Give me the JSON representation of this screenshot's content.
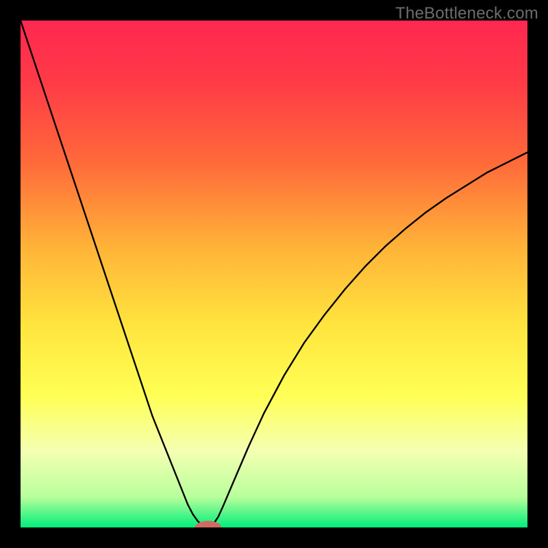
{
  "watermark": "TheBottleneck.com",
  "chart_data": {
    "type": "line",
    "title": "",
    "xlabel": "",
    "ylabel": "",
    "xlim": [
      0,
      100
    ],
    "ylim": [
      0,
      100
    ],
    "grid": false,
    "gradient_stops": [
      {
        "offset": 0.0,
        "color": "#ff2850"
      },
      {
        "offset": 0.12,
        "color": "#ff3a47"
      },
      {
        "offset": 0.28,
        "color": "#ff6a3a"
      },
      {
        "offset": 0.45,
        "color": "#ffb438"
      },
      {
        "offset": 0.6,
        "color": "#ffe43e"
      },
      {
        "offset": 0.74,
        "color": "#ffff55"
      },
      {
        "offset": 0.85,
        "color": "#f4ffb2"
      },
      {
        "offset": 0.94,
        "color": "#b8ff9c"
      },
      {
        "offset": 1.0,
        "color": "#00ee7a"
      }
    ],
    "series": [
      {
        "name": "left-curve",
        "x": [
          0,
          2,
          4,
          6,
          8,
          10,
          12,
          14,
          16,
          18,
          20,
          22,
          24,
          26,
          28,
          30,
          32,
          33,
          34,
          35,
          36,
          37
        ],
        "y": [
          100,
          94,
          88,
          82,
          76,
          70,
          64,
          58,
          52,
          46,
          40,
          34,
          28,
          22,
          17,
          12,
          7,
          4.5,
          2.6,
          1.2,
          0.3,
          0
        ]
      },
      {
        "name": "right-curve",
        "x": [
          37,
          38,
          39,
          40,
          42,
          45,
          48,
          52,
          56,
          60,
          64,
          68,
          72,
          76,
          80,
          84,
          88,
          92,
          96,
          100
        ],
        "y": [
          0,
          0.6,
          2.1,
          4.3,
          9.0,
          16.0,
          22.5,
          30.0,
          36.5,
          42.0,
          47.0,
          51.5,
          55.5,
          59.0,
          62.2,
          65.0,
          67.5,
          70.0,
          72.0,
          74.0
        ]
      }
    ],
    "marker": {
      "x": 37,
      "y": 0,
      "rx": 2.6,
      "ry": 1.3,
      "color": "#d06a62"
    }
  }
}
